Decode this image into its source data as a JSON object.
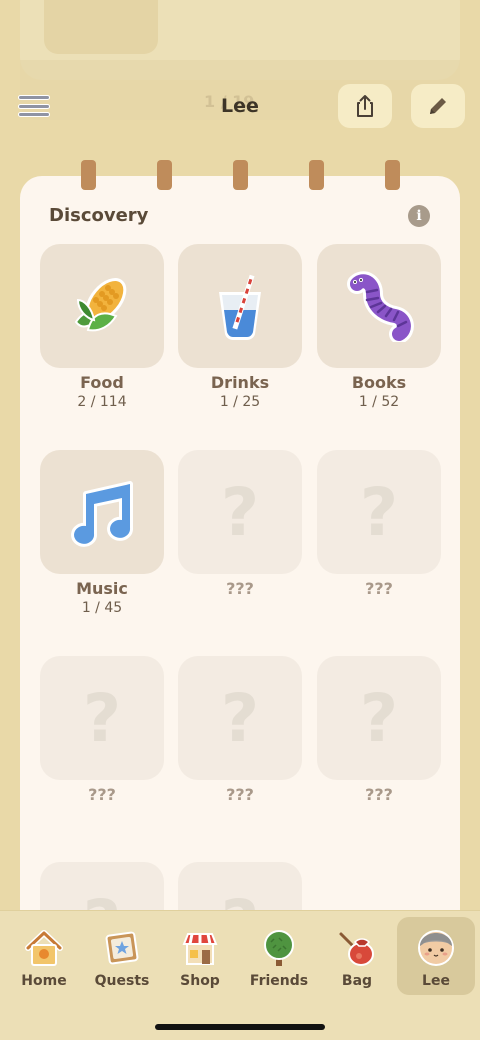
{
  "header": {
    "title": "Lee",
    "ghost_page_text": "1 / 19"
  },
  "discovery": {
    "title": "Discovery",
    "categories": [
      {
        "label": "Food",
        "count": "2 / 114",
        "icon": "corn-icon"
      },
      {
        "label": "Drinks",
        "count": "1 / 25",
        "icon": "drink-glass-icon"
      },
      {
        "label": "Books",
        "count": "1 / 52",
        "icon": "bookworm-icon"
      },
      {
        "label": "Music",
        "count": "1 / 45",
        "icon": "music-note-icon"
      },
      {
        "label": "???",
        "count": ""
      },
      {
        "label": "???",
        "count": ""
      },
      {
        "label": "???",
        "count": ""
      },
      {
        "label": "???",
        "count": ""
      },
      {
        "label": "???",
        "count": ""
      }
    ],
    "locked_symbol": "?"
  },
  "nav": {
    "items": [
      {
        "label": "Home",
        "icon": "house-icon"
      },
      {
        "label": "Quests",
        "icon": "quest-board-icon"
      },
      {
        "label": "Shop",
        "icon": "shop-icon"
      },
      {
        "label": "Friends",
        "icon": "tree-icon"
      },
      {
        "label": "Bag",
        "icon": "bag-icon"
      },
      {
        "label": "Lee",
        "icon": "avatar-icon",
        "active": true
      }
    ]
  },
  "colors": {
    "background": "#e9d9a8",
    "notebook": "#fdf6ee",
    "tile": "#ece1d2",
    "ring": "#bf8c5b"
  }
}
